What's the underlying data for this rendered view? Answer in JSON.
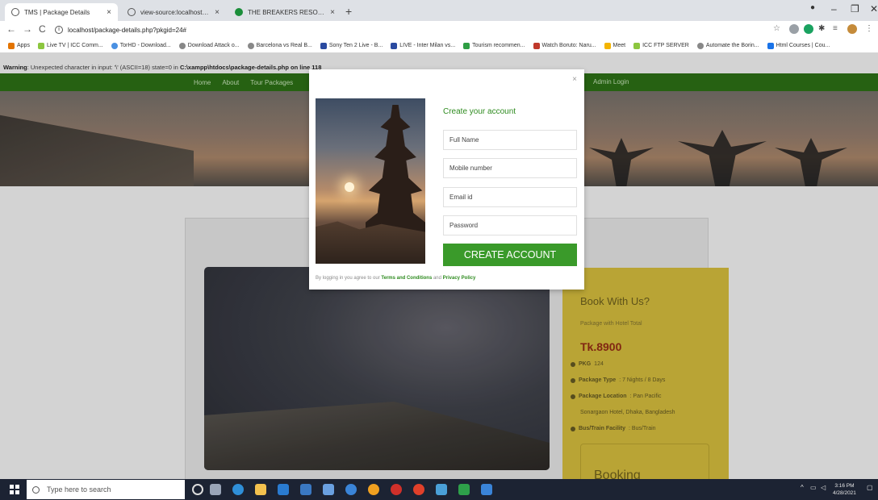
{
  "browser": {
    "tabs": [
      {
        "label": "TMS | Package Details",
        "active": true
      },
      {
        "label": "view-source:localhost/package-d",
        "active": false
      },
      {
        "label": "THE BREAKERS RESORT - Update",
        "active": false
      }
    ],
    "url": "localhost/package-details.php?pkgid=24#",
    "bookmarks": [
      "Apps",
      "Live TV | ICC Comm...",
      "TorHD - Download...",
      "Download Attack o...",
      "Barcelona vs Real B...",
      "Sony Ten 2 Live - B...",
      "LIVE - Inter Milan vs...",
      "Tourism recommen...",
      "Watch Boruto: Naru...",
      "Meet",
      "ICC FTP SERVER",
      "Automate the Borin...",
      "Html Courses | Cou..."
    ]
  },
  "page": {
    "warning_label": "Warning",
    "warning_text": ": Unexpected character in input: '\\' (ASCII=18) state=0 in ",
    "warning_path": "C:\\xampp\\htdocs\\package-details.php on line 118",
    "nav_items": [
      "Home",
      "About",
      "Tour Packages"
    ],
    "nav_right": "Admin Login",
    "book": {
      "title": "Book With Us?",
      "subtitle": "Package with Hotel Total",
      "price": "Tk.8900",
      "pkg_label": "PKG",
      "pkg_value": "124",
      "type_label": "Package Type",
      "type_value": ": 7 Nights / 8 Days",
      "location_label": "Package Location",
      "location_value": ": Pan Pacific",
      "location_value_2": "Sonargaon Hotel, Dhaka, Bangladesh",
      "transport_label": "Bus/Train Facility",
      "transport_value": ": Bus/Train",
      "booking_heading": "Booking"
    }
  },
  "modal": {
    "close": "×",
    "title": "Create your account",
    "full_name_placeholder": "Full Name",
    "mobile_placeholder": "Mobile number",
    "email_placeholder": "Email id",
    "password_placeholder": "Password",
    "submit": "CREATE ACCOUNT",
    "terms_prefix": "By logging in you agree to our ",
    "terms_link": "Terms and Conditions",
    "terms_mid": " and ",
    "privacy_link": "Privacy Policy"
  },
  "taskbar": {
    "search_placeholder": "Type here to search",
    "time": "3:16 PM",
    "date": "4/28/2021"
  },
  "colors": {
    "accent_green": "#3a9a2a",
    "nav_green": "#2a6a14",
    "booking_panel": "#c9b23a",
    "price_red": "#8c2a14"
  }
}
